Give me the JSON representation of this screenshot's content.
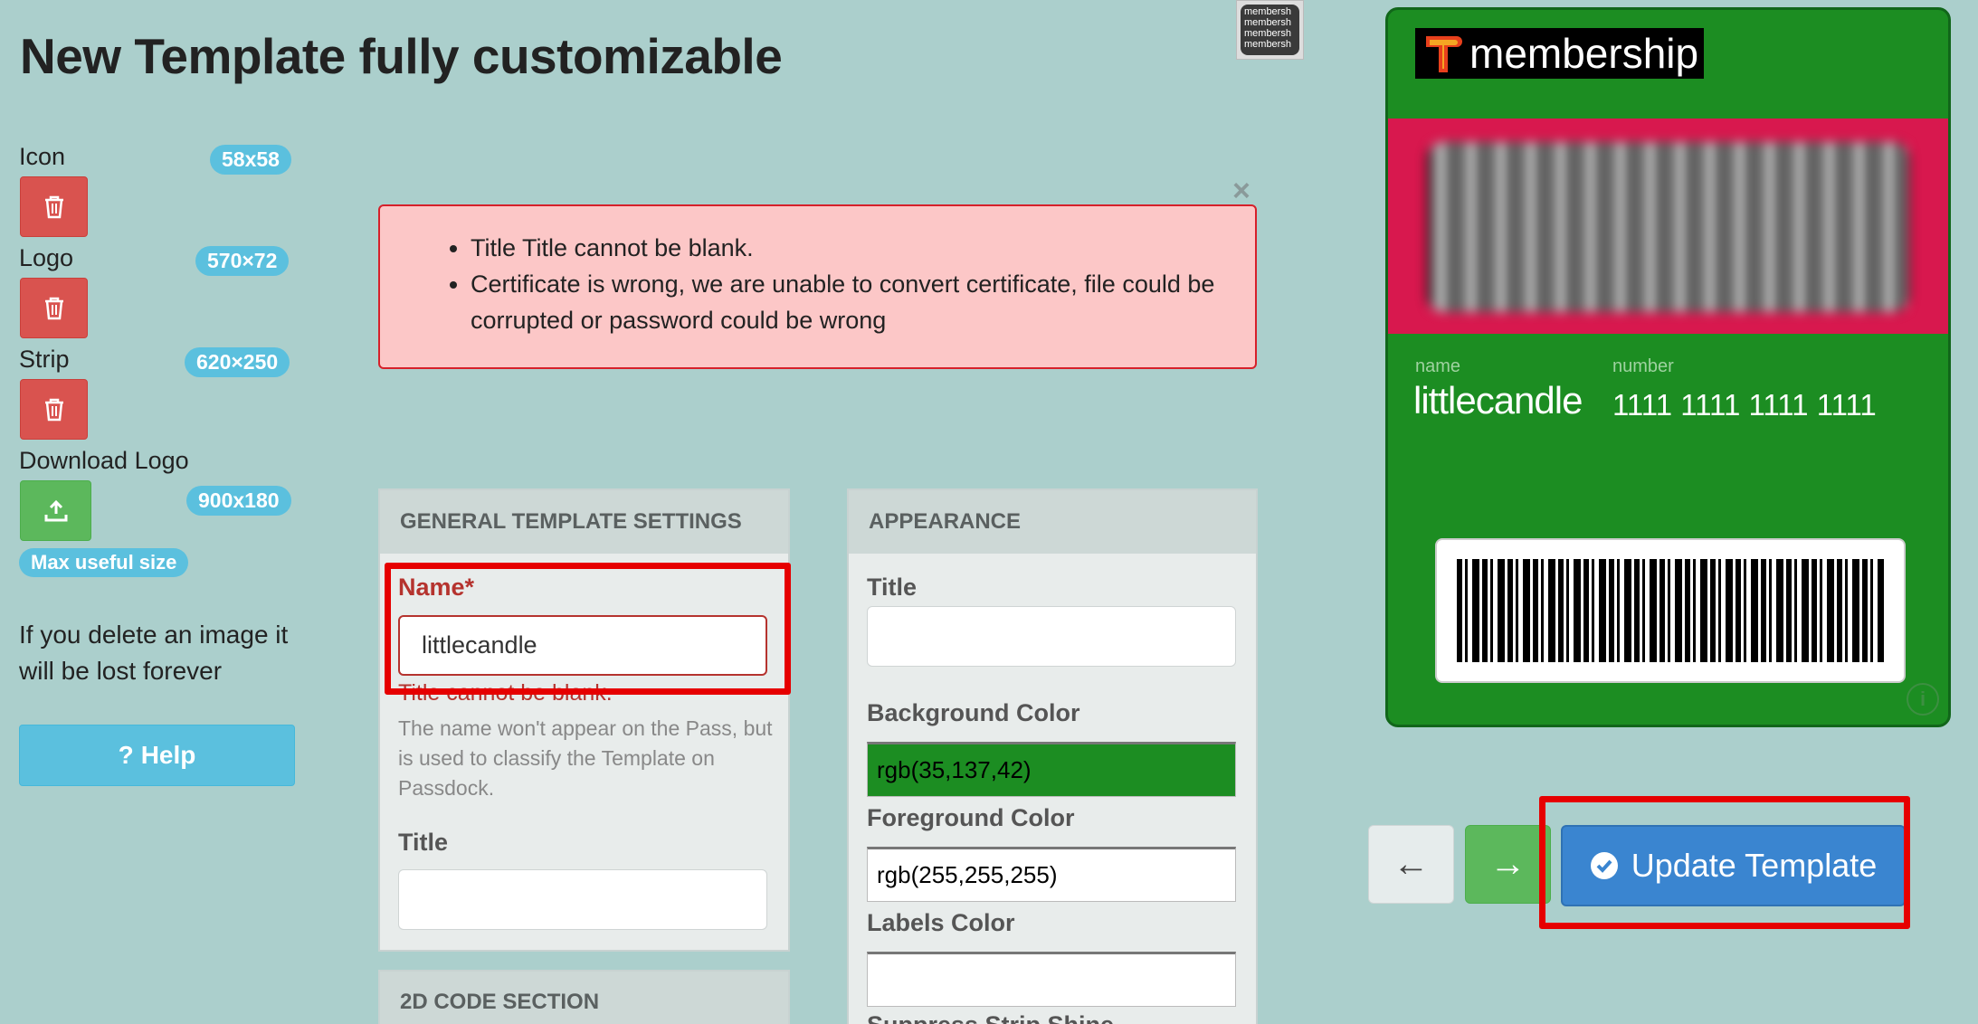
{
  "page": {
    "title": "New Template fully customizable"
  },
  "thumbnail": {
    "lines": [
      "membersh",
      "membersh",
      "membersh",
      "membersh"
    ]
  },
  "sidebar": {
    "icon": {
      "label": "Icon",
      "size": "58x58"
    },
    "logo": {
      "label": "Logo",
      "size": "570×72"
    },
    "strip": {
      "label": "Strip",
      "size": "620×250"
    },
    "download_logo": {
      "label": "Download Logo",
      "size": "900x180"
    },
    "max_useful": "Max useful size",
    "note": "If you delete an image it will be lost forever",
    "help_label": "Help",
    "help_prefix": "?"
  },
  "alert": {
    "errors": [
      "Title Title cannot be blank.",
      "Certificate is wrong, we are unable to convert certificate, file could be corrupted or password could be wrong"
    ],
    "close": "×"
  },
  "general": {
    "header": "GENERAL TEMPLATE SETTINGS",
    "name_label": "Name*",
    "name_value": "littlecandle",
    "name_error": "Title cannot be blank.",
    "name_help": "The name won't appear on the Pass, but is used to classify the Template on Passdock.",
    "title_label": "Title",
    "title_value": ""
  },
  "code_section": {
    "header": "2D CODE SECTION"
  },
  "appearance": {
    "header": "APPEARANCE",
    "title_label": "Title",
    "title_value": "",
    "bg_label": "Background Color",
    "bg_value": "rgb(35,137,42)",
    "fg_label": "Foreground Color",
    "fg_value": "rgb(255,255,255)",
    "labels_label": "Labels Color",
    "labels_value": "",
    "suppress_label": "Suppress Strip Shine"
  },
  "pass": {
    "logo_text": "membership",
    "name_label": "name",
    "name_value": "littlecandle",
    "number_label": "number",
    "number_value": "1111 1111 1111 1111",
    "info": "i",
    "colors": {
      "background": "#1c8d22",
      "strip": "#d8184e"
    }
  },
  "actions": {
    "back": "←",
    "forward": "→",
    "update_label": "Update Template"
  }
}
